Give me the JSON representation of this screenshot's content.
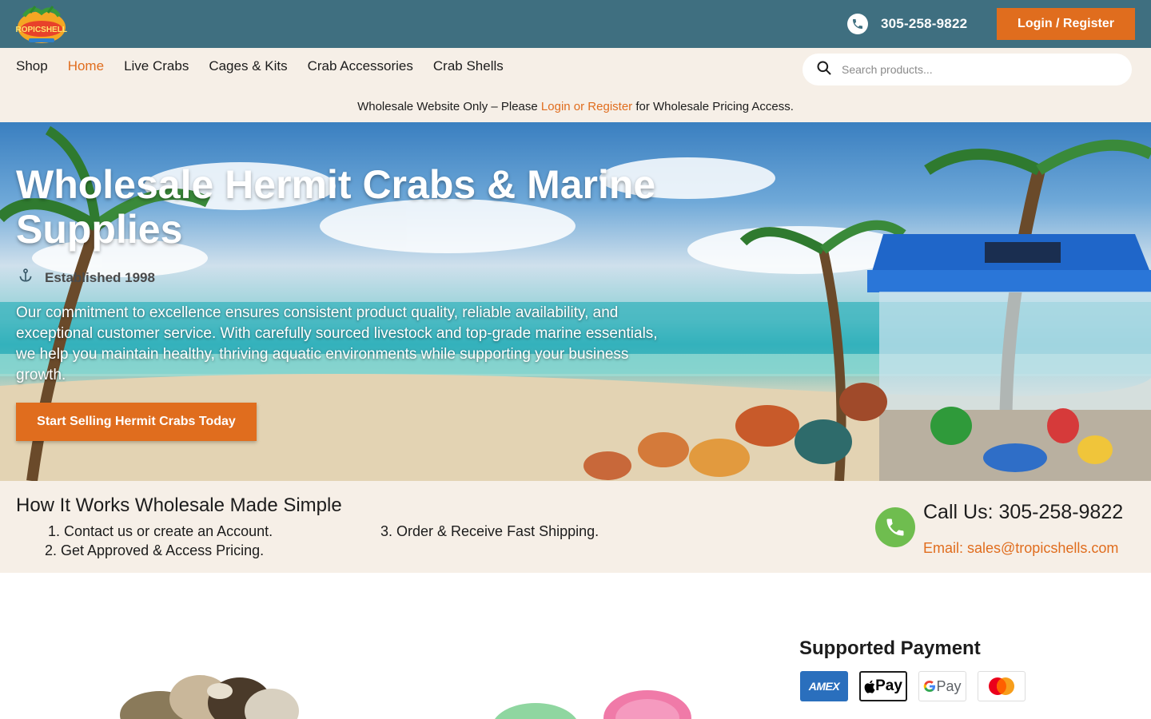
{
  "header": {
    "logo_text": "TROPICSHELLS",
    "phone": "305-258-9822",
    "login_label": "Login / Register"
  },
  "nav": {
    "items": [
      {
        "label": "Shop"
      },
      {
        "label": "Home",
        "active": true
      },
      {
        "label": "Live Crabs"
      },
      {
        "label": "Cages & Kits"
      },
      {
        "label": "Crab Accessories"
      },
      {
        "label": "Crab Shells"
      }
    ],
    "search_placeholder": "Search products..."
  },
  "notice": {
    "prefix": "Wholesale Website Only – Please ",
    "link": "Login or Register",
    "suffix": " for Wholesale Pricing Access."
  },
  "hero": {
    "title": "Wholesale Hermit Crabs & Marine Supplies",
    "established": "Established 1998",
    "description": "Our commitment to excellence ensures consistent product quality, reliable availability, and exceptional customer service. With carefully sourced livestock and top-grade marine essentials, we help you maintain healthy, thriving aquatic environments while supporting your business growth.",
    "cta_label": "Start Selling Hermit Crabs Today"
  },
  "how": {
    "title": "How It Works Wholesale Made Simple",
    "steps": [
      "1. Contact us or create an Account.",
      "2. Get Approved & Access Pricing.",
      "3. Order & Receive Fast Shipping."
    ],
    "call_label": "Call Us: 305-258-9822",
    "email_label": "Email: sales@tropicshells.com"
  },
  "payment": {
    "title": "Supported Payment",
    "methods": [
      {
        "name": "AMEX",
        "icon": "amex-card-icon"
      },
      {
        "name": "Pay",
        "icon": "apple-pay-icon"
      },
      {
        "name": "Pay",
        "icon": "google-pay-icon"
      },
      {
        "name": "",
        "icon": "mastercard-icon"
      }
    ]
  },
  "colors": {
    "topbar": "#3f6f80",
    "accent": "#e06d1e",
    "cream": "#f6efe7",
    "call_green": "#6fbd4f"
  }
}
